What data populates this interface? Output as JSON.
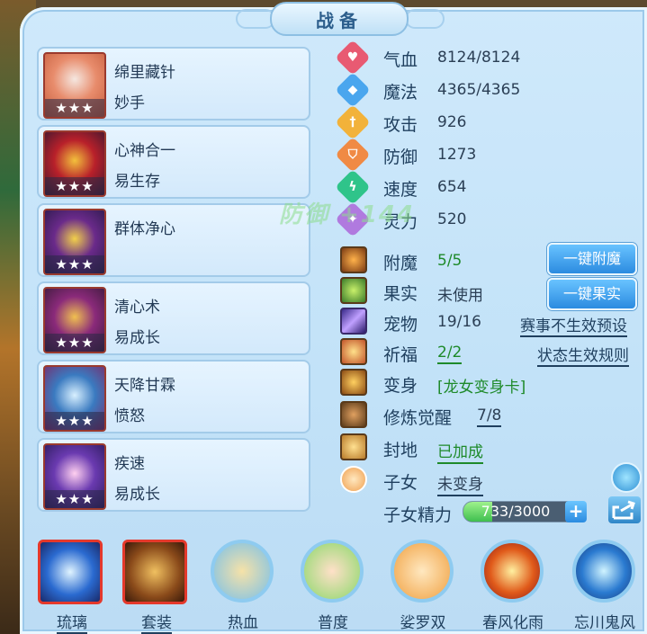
{
  "title": "战备",
  "watermark": "防御 +144",
  "skills": [
    {
      "name": "绵里藏针",
      "sub": "妙手",
      "stars": "★★★",
      "icon": "needle-skill-icon"
    },
    {
      "name": "心神合一",
      "sub": "易生存",
      "stars": "★★★",
      "icon": "mind-skill-icon"
    },
    {
      "name": "群体净心",
      "sub": "",
      "stars": "★★★",
      "icon": "purify-skill-icon"
    },
    {
      "name": "清心术",
      "sub": "易成长",
      "stars": "★★★",
      "icon": "calm-skill-icon"
    },
    {
      "name": "天降甘霖",
      "sub": "愤怒",
      "stars": "★★★",
      "icon": "rain-skill-icon"
    },
    {
      "name": "疾速",
      "sub": "易成长",
      "stars": "★★★",
      "icon": "speed-skill-icon"
    }
  ],
  "stats": [
    {
      "label": "气血",
      "value": "8124/8124",
      "icon": "heart-icon",
      "color": "#e85a72"
    },
    {
      "label": "魔法",
      "value": "4365/4365",
      "icon": "mana-icon",
      "color": "#4aa6ee"
    },
    {
      "label": "攻击",
      "value": "926",
      "icon": "sword-icon",
      "color": "#f2b23a"
    },
    {
      "label": "防御",
      "value": "1273",
      "icon": "shield-icon",
      "color": "#f08a44"
    },
    {
      "label": "速度",
      "value": "654",
      "icon": "speed-icon",
      "color": "#2fc48a"
    },
    {
      "label": "灵力",
      "value": "520",
      "icon": "spirit-icon",
      "color": "#b07adf"
    }
  ],
  "features": {
    "enchant": {
      "label": "附魔",
      "value": "5/5",
      "button": "一键附魔"
    },
    "fruit": {
      "label": "果实",
      "value": "未使用",
      "button": "一键果实"
    },
    "pet": {
      "label": "宠物",
      "value": "19/16",
      "link": "赛事不生效预设"
    },
    "blessing": {
      "label": "祈福",
      "value": "2/2",
      "link": "状态生效规则"
    },
    "transform": {
      "label": "变身",
      "value": "[龙女变身卡]"
    },
    "cultivation": {
      "label": "修炼觉醒",
      "value": "7/8"
    },
    "seal": {
      "label": "封地",
      "value": "已加成"
    },
    "child": {
      "label": "子女",
      "value": "未变身"
    },
    "child_energy": {
      "label": "子女精力",
      "value": "733/3000",
      "current": 733,
      "max": 3000
    }
  },
  "bottom_tabs": [
    {
      "label": "琉璃",
      "icon": "glaze-orb-icon",
      "underline": true
    },
    {
      "label": "套装",
      "icon": "armor-set-icon",
      "underline": true
    },
    {
      "label": "热血",
      "icon": "hot-blood-icon",
      "underline": false
    },
    {
      "label": "普度",
      "icon": "salvation-hand-icon",
      "underline": false
    },
    {
      "label": "娑罗双",
      "icon": "sala-twin-icon",
      "underline": false
    },
    {
      "label": "春风化雨",
      "icon": "spring-rain-icon",
      "underline": false
    },
    {
      "label": "忘川鬼风",
      "icon": "ghost-wind-icon",
      "underline": false
    }
  ]
}
